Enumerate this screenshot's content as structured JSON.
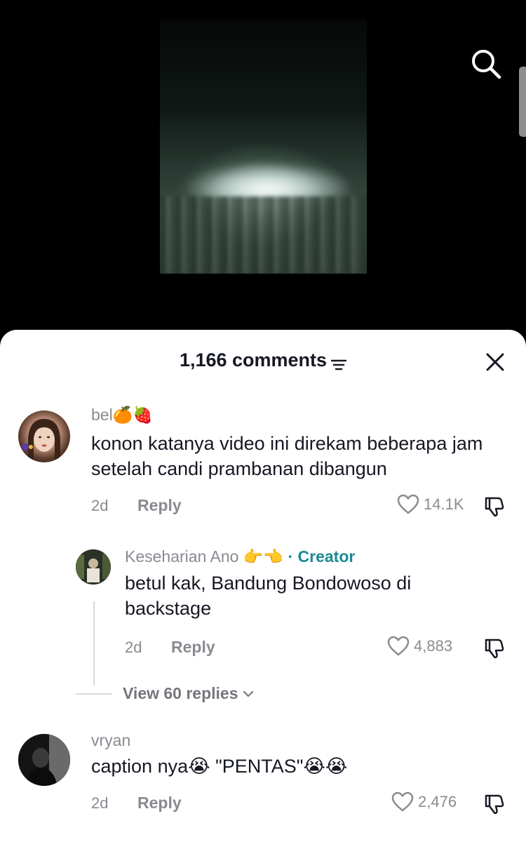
{
  "header": {
    "comment_count_label": "1,166 comments"
  },
  "icons": {
    "search": "search-icon",
    "filter": "filter-icon",
    "close": "close-icon",
    "heart": "heart-icon",
    "dislike": "dislike-icon",
    "chevron": "chevron-down-icon"
  },
  "colors": {
    "creator": "#1a8a93",
    "muted": "#8a8b91",
    "text": "#161823"
  },
  "comments": [
    {
      "username": "bel🍊🍓",
      "text": "konon katanya video ini direkam beberapa jam setelah candi prambanan dibangun",
      "time": "2d",
      "reply_label": "Reply",
      "likes": "14.1K"
    },
    {
      "username": "Keseharian Ano 👉👈",
      "creator_label": "· Creator",
      "text": "betul kak, Bandung Bondowoso di backstage",
      "time": "2d",
      "reply_label": "Reply",
      "likes": "4,883"
    },
    {
      "username": "vryan",
      "text": "caption nya😭 \"PENTAS\"😭😭",
      "time": "2d",
      "reply_label": "Reply",
      "likes": "2,476"
    }
  ],
  "view_replies_label": "View 60 replies"
}
